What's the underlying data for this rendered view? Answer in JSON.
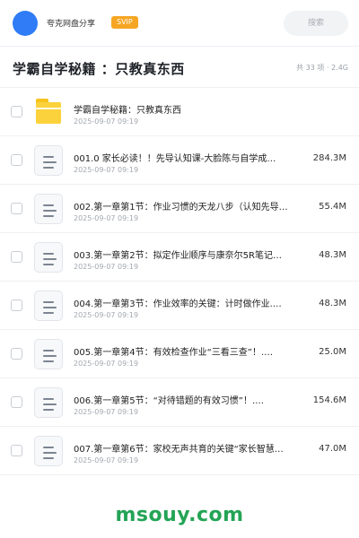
{
  "header": {
    "share_title": "夸克网盘分享",
    "svip_badge": "SVIP",
    "search_placeholder": "搜索"
  },
  "folder": {
    "title": "学霸自学秘籍 ：只教真东西",
    "meta": "共 33 项 · 2.4G"
  },
  "files": [
    {
      "name": "学霸自学秘籍：只教真东西",
      "date": "2025-09-07 09:19",
      "size": "",
      "icon": "folder-icon"
    },
    {
      "name": "001.0 家长必读！！先导认知课-大脸陈与自学成…",
      "date": "2025-09-07 09:19",
      "size": "284.3M",
      "icon": "document-icon"
    },
    {
      "name": "002.第一章第1节：作业习惯的天龙八步（认知先导…",
      "date": "2025-09-07 09:19",
      "size": "55.4M",
      "icon": "document-icon"
    },
    {
      "name": "003.第一章第2节：拟定作业顺序与康奈尔5R笔记…",
      "date": "2025-09-07 09:19",
      "size": "48.3M",
      "icon": "document-icon"
    },
    {
      "name": "004.第一章第3节：作业效率的关键：计时做作业.…",
      "date": "2025-09-07 09:19",
      "size": "48.3M",
      "icon": "document-icon"
    },
    {
      "name": "005.第一章第4节：有效检查作业“三看三查”！.…",
      "date": "2025-09-07 09:19",
      "size": "25.0M",
      "icon": "document-icon"
    },
    {
      "name": "006.第一章第5节：“对待错题的有效习惯”！.…",
      "date": "2025-09-07 09:19",
      "size": "154.6M",
      "icon": "document-icon"
    },
    {
      "name": "007.第一章第6节：家校无声共育的关键“家长智慧…",
      "date": "2025-09-07 09:19",
      "size": "47.0M",
      "icon": "document-icon"
    }
  ],
  "watermark": "msouy.com",
  "colors": {
    "avatar": "#2f7cf6",
    "svip": "#f6a623",
    "folder": "#fbd23c",
    "watermark": "#23a455"
  }
}
